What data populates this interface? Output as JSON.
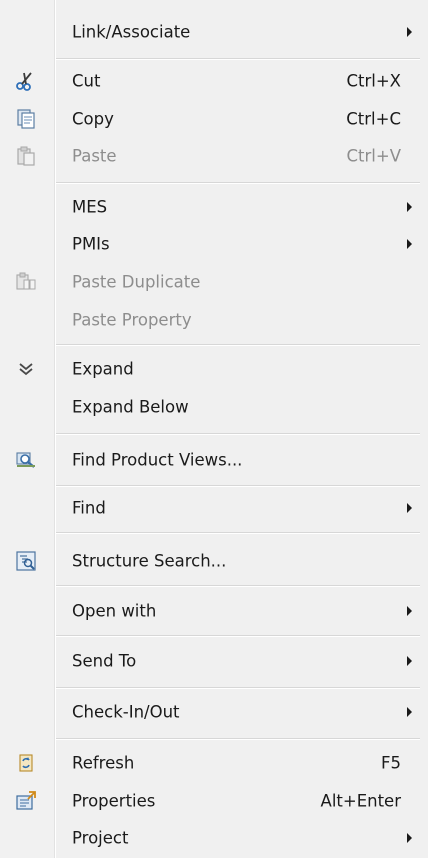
{
  "menu": {
    "items": [
      {
        "label": "Link/Associate"
      },
      {
        "label": "Cut",
        "shortcut": "Ctrl+X"
      },
      {
        "label": "Copy",
        "shortcut": "Ctrl+C"
      },
      {
        "label": "Paste",
        "shortcut": "Ctrl+V"
      },
      {
        "label": "MES"
      },
      {
        "label": "PMIs"
      },
      {
        "label": "Paste Duplicate"
      },
      {
        "label": "Paste Property"
      },
      {
        "label": "Expand"
      },
      {
        "label": "Expand Below"
      },
      {
        "label": "Find Product Views..."
      },
      {
        "label": "Find"
      },
      {
        "label": "Structure Search..."
      },
      {
        "label": "Open with"
      },
      {
        "label": "Send To"
      },
      {
        "label": "Check-In/Out"
      },
      {
        "label": "Refresh",
        "shortcut": "F5"
      },
      {
        "label": "Properties",
        "shortcut": "Alt+Enter"
      },
      {
        "label": "Project"
      }
    ]
  }
}
